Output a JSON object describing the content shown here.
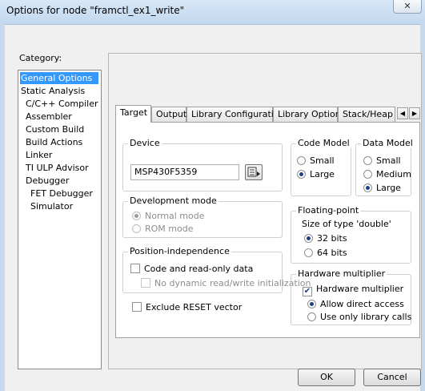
{
  "window": {
    "title": "Options for node \"framctl_ex1_write\"",
    "close_symbol": "✕"
  },
  "category": {
    "label": "Category:",
    "items": [
      {
        "label": "General Options",
        "selected": true
      },
      {
        "label": "Static Analysis"
      },
      {
        "label": "C/C++ Compiler"
      },
      {
        "label": "Assembler"
      },
      {
        "label": "Custom Build"
      },
      {
        "label": "Build Actions"
      },
      {
        "label": "Linker"
      },
      {
        "label": "TI ULP Advisor"
      },
      {
        "label": "Debugger"
      },
      {
        "label": "FET Debugger"
      },
      {
        "label": "Simulator"
      }
    ]
  },
  "tabs": {
    "items": [
      "Target",
      "Output",
      "Library Configuration",
      "Library Options",
      "Stack/Heap"
    ],
    "active": "Target",
    "scroll_left": "◀",
    "scroll_right": "▶"
  },
  "device": {
    "label": "Device",
    "value": "MSP430F5359",
    "browse_icon": "browse-list-icon"
  },
  "code_model": {
    "label": "Code Model",
    "options": [
      "Small",
      "Large"
    ],
    "selected": "Large"
  },
  "data_model": {
    "label": "Data Model",
    "options": [
      "Small",
      "Medium",
      "Large"
    ],
    "selected": "Large"
  },
  "dev_mode": {
    "label": "Development mode",
    "options": [
      "Normal mode",
      "ROM mode"
    ],
    "selected": "Normal mode"
  },
  "floating": {
    "label": "Floating-point",
    "size_label": "Size of type 'double'",
    "options": [
      "32 bits",
      "64 bits"
    ],
    "selected": "32 bits"
  },
  "position_independence": {
    "label": "Position-independence",
    "code_readonly": "Code and read-only data",
    "no_dynamic": "No dynamic read/write initialization"
  },
  "hw_multiplier": {
    "label": "Hardware multiplier",
    "checkbox": "Hardware multiplier",
    "options": [
      "Allow direct access",
      "Use only library calls"
    ],
    "selected": "Allow direct access"
  },
  "exclude_reset": "Exclude RESET vector",
  "buttons": {
    "ok": "OK",
    "cancel": "Cancel"
  }
}
